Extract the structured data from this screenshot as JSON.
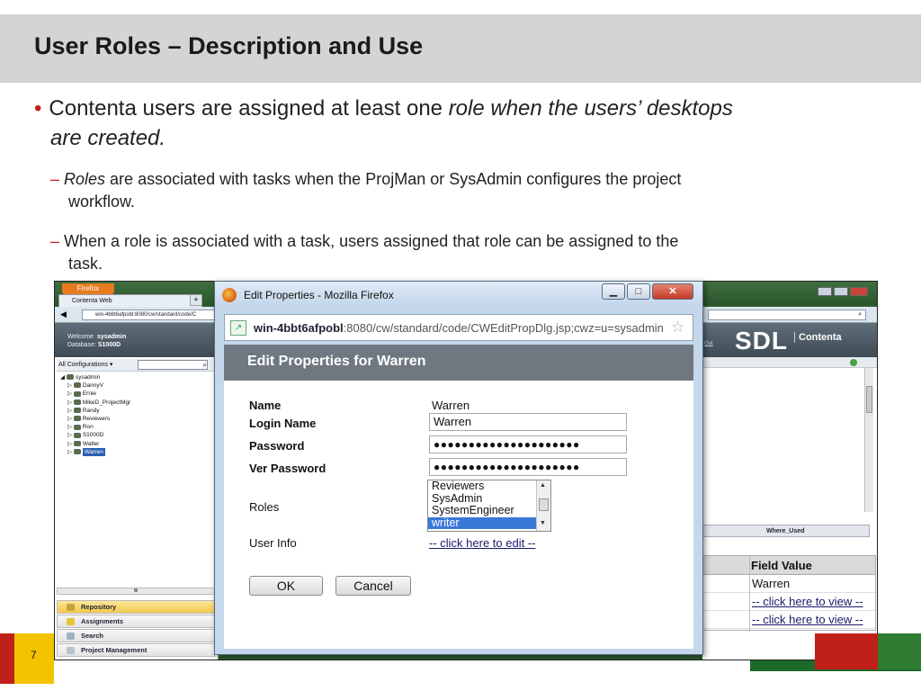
{
  "slide": {
    "title": "User Roles – Description and Use",
    "bullet_main_prefix": "Contenta users are assigned at least one ",
    "bullet_main_italic_1": "role when the users’ desktops",
    "bullet_main_italic_2": "are created.",
    "sub1_italic": "Roles",
    "sub1_text": " are associated with tasks when the ProjMan or SysAdmin configures the project",
    "sub1_cont": "workflow.",
    "sub2_text": " When a role is associated with a task, users assigned that role can be assigned to the",
    "sub2_cont": "task.",
    "page_number": "7"
  },
  "bg_browser": {
    "firefox_button": "Firefox",
    "tab_label": "Contenta Web",
    "tab_plus": "+",
    "address": "win-4bbt6afpobl:8080/cw/standard/code/C",
    "welcome_label": "Welcome",
    "welcome_user": "sysadmin",
    "database_label": "Database:",
    "database_value": "S1000D",
    "logout": "Out",
    "logo_sdl": "SDL",
    "logo_contenta": "Contenta",
    "config_select": "All Configurations",
    "tree": [
      "sysadmin",
      "DannyV",
      "Ernie",
      "MikeD_ProjectMgr",
      "Randy",
      "Reviewers",
      "Ron",
      "S1000D",
      "Walter",
      "Warren"
    ],
    "nav": [
      "Repository",
      "Assignments",
      "Search",
      "Project Management"
    ],
    "where_used": "Where_Used",
    "field_value_header": "Field Value",
    "field_values": [
      "Warren",
      "-- click here to view --",
      "-- click here to view --"
    ]
  },
  "dialog": {
    "window_title": "Edit Properties - Mozilla Firefox",
    "url_host": "win-4bbt6afpobl",
    "url_path": ":8080/cw/standard/code/CWEditPropDlg.jsp;cwz=u=sysadmin",
    "heading": "Edit Properties for Warren",
    "name_label": "Name",
    "name_value": "Warren",
    "login_label": "Login Name",
    "login_value": "Warren",
    "password_label": "Password",
    "password_value": "●●●●●●●●●●●●●●●●●●●●●",
    "ver_password_label": "Ver Password",
    "ver_password_value": "●●●●●●●●●●●●●●●●●●●●●",
    "roles_label": "Roles",
    "roles_options": [
      "Reviewers",
      "SysAdmin",
      "SystemEngineer",
      "writer"
    ],
    "roles_selected": "writer",
    "user_info_label": "User Info",
    "user_info_link": "-- click here to edit --",
    "ok_label": "OK",
    "cancel_label": "Cancel"
  },
  "colors": {
    "accent_red": "#c0201a",
    "accent_yellow": "#f3c300",
    "accent_green": "#2e7d32",
    "header_gray": "#d4d4d4",
    "selection_blue": "#3a78d8"
  }
}
